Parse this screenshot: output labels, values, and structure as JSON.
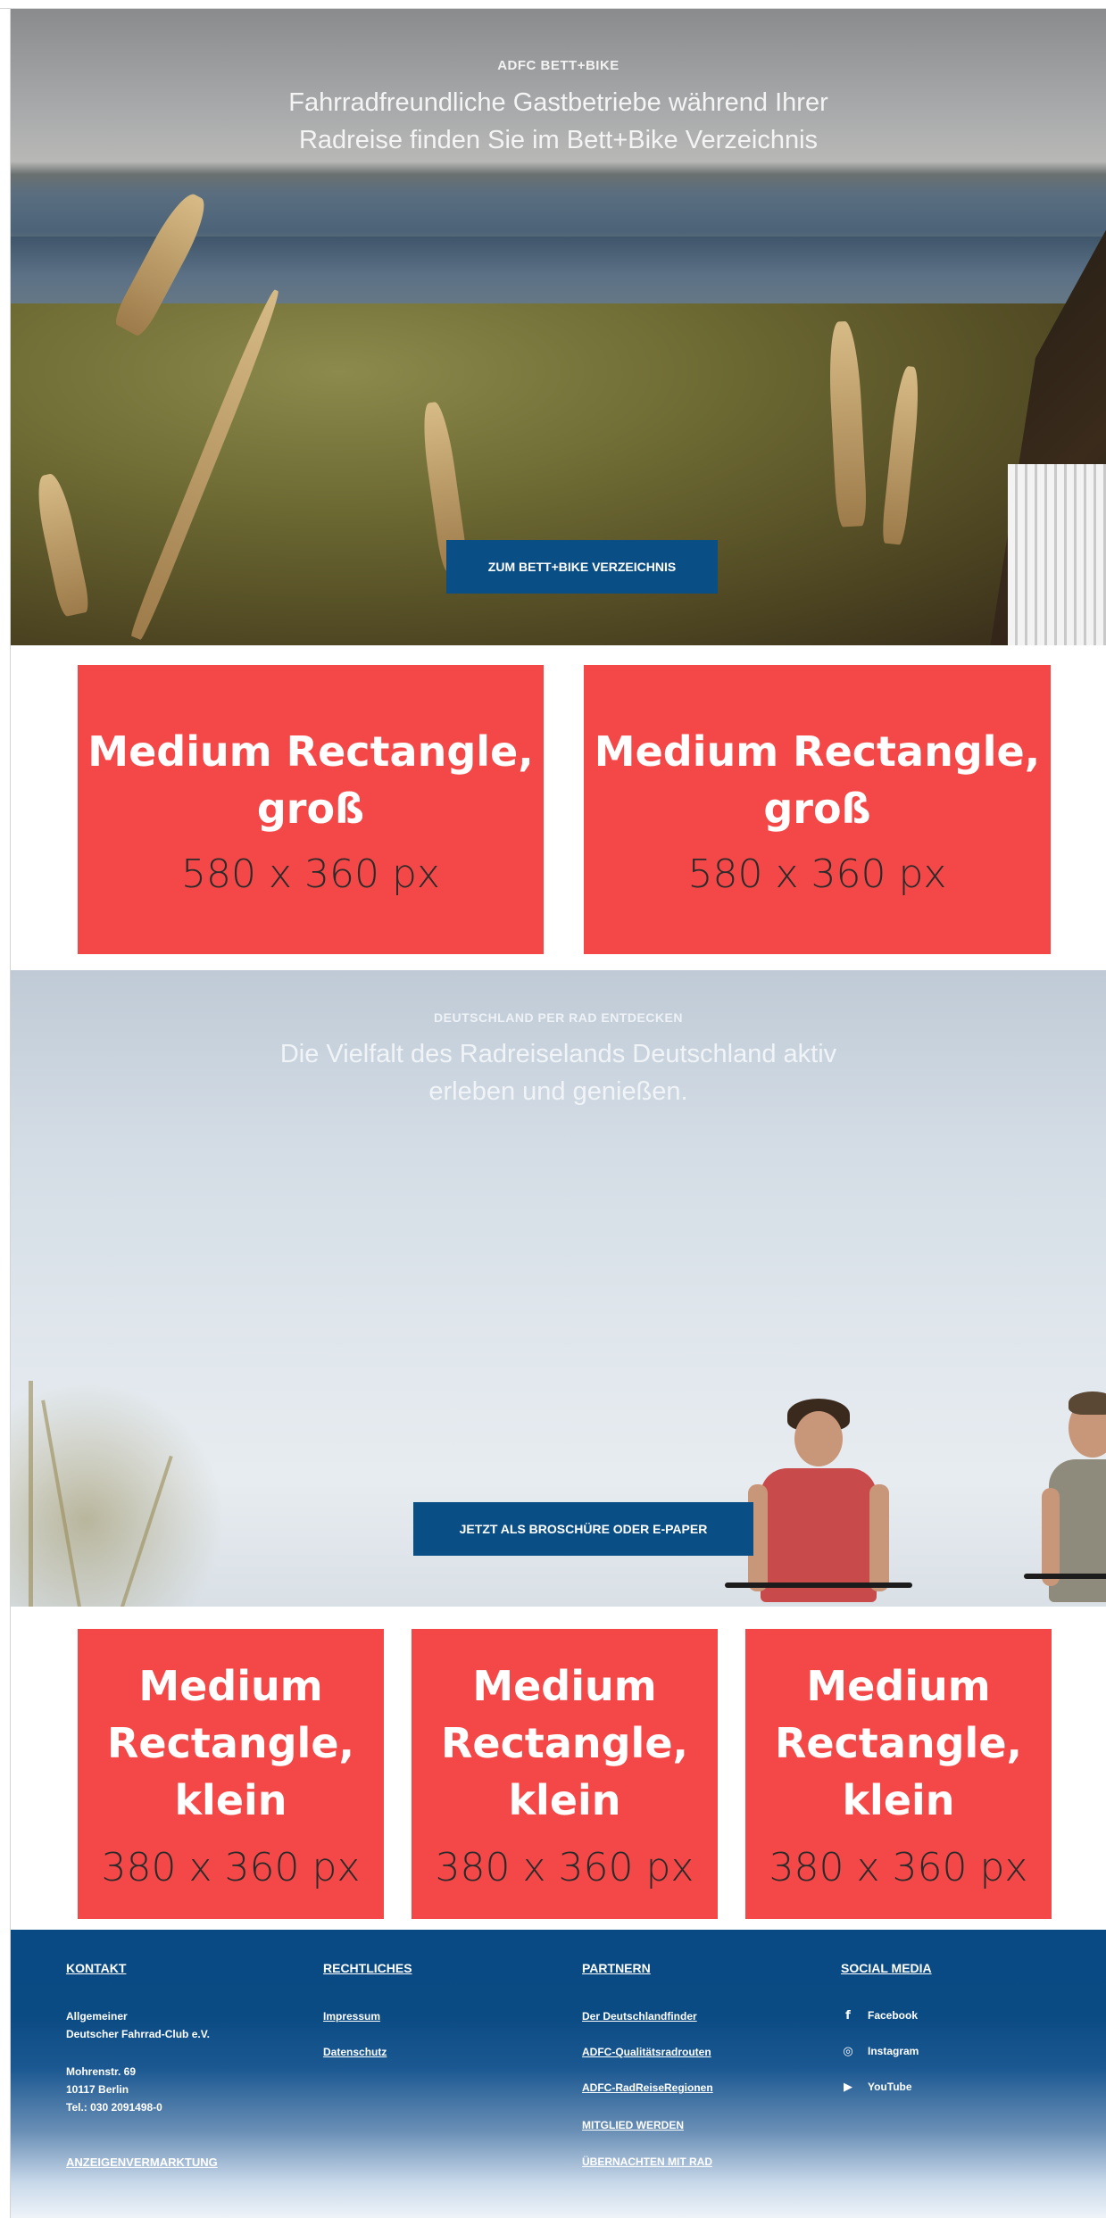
{
  "hero_bettbike": {
    "eyebrow": "ADFC BETT+BIKE",
    "title_line1": "Fahrradfreundliche Gastbetriebe während Ihrer",
    "title_line2": "Radreise finden Sie im Bett+Bike Verzeichnis",
    "cta_label": "ZUM BETT+BIKE VERZEICHNIS"
  },
  "ads_large": [
    {
      "name_line1": "Medium Rectangle,",
      "name_line2": "groß",
      "size": "580 x 360 px"
    },
    {
      "name_line1": "Medium Rectangle,",
      "name_line2": "groß",
      "size": "580 x 360 px"
    }
  ],
  "hero_deutschland": {
    "eyebrow": "DEUTSCHLAND PER RAD ENTDECKEN",
    "title_line1": "Die Vielfalt des Radreiselands Deutschland aktiv",
    "title_line2": "erleben und genießen.",
    "cta_label": "JETZT ALS BROSCHÜRE ODER E-PAPER"
  },
  "ads_small": [
    {
      "name_line1": "Medium",
      "name_line2": "Rectangle,",
      "name_line3": "klein",
      "size": "380 x 360 px"
    },
    {
      "name_line1": "Medium",
      "name_line2": "Rectangle,",
      "name_line3": "klein",
      "size": "380 x 360 px"
    },
    {
      "name_line1": "Medium",
      "name_line2": "Rectangle,",
      "name_line3": "klein",
      "size": "380 x 360 px"
    }
  ],
  "footer": {
    "kontakt": {
      "heading": "KONTAKT",
      "org_line1": "Allgemeiner",
      "org_line2": "Deutscher Fahrrad-Club e.V.",
      "addr_line1": "Mohrenstr. 69",
      "addr_line2": "10117 Berlin",
      "phone": "Tel.: 030 2091498-0",
      "anzeigen": "ANZEIGENVERMARKTUNG"
    },
    "rechtliches": {
      "heading": "RECHTLICHES",
      "items": [
        "Impressum",
        "Datenschutz"
      ]
    },
    "partner": {
      "heading": "PARTNERN",
      "items": [
        "Der Deutschlandfinder",
        "ADFC-Qualitätsradrouten",
        "ADFC-RadReiseRegionen"
      ],
      "extra1": "MITGLIED WERDEN",
      "extra2": "ÜBERNACHTEN MIT RAD"
    },
    "social": {
      "heading": "SOCIAL MEDIA",
      "items": [
        {
          "icon": "facebook-icon",
          "glyph": "f",
          "label": "Facebook"
        },
        {
          "icon": "instagram-icon",
          "glyph": "◎",
          "label": "Instagram"
        },
        {
          "icon": "youtube-icon",
          "glyph": "▶",
          "label": "YouTube"
        }
      ]
    }
  },
  "colors": {
    "ad_red": "#f44848",
    "cta_blue": "#0a4e86",
    "footer_blue": "#0a4a84"
  }
}
